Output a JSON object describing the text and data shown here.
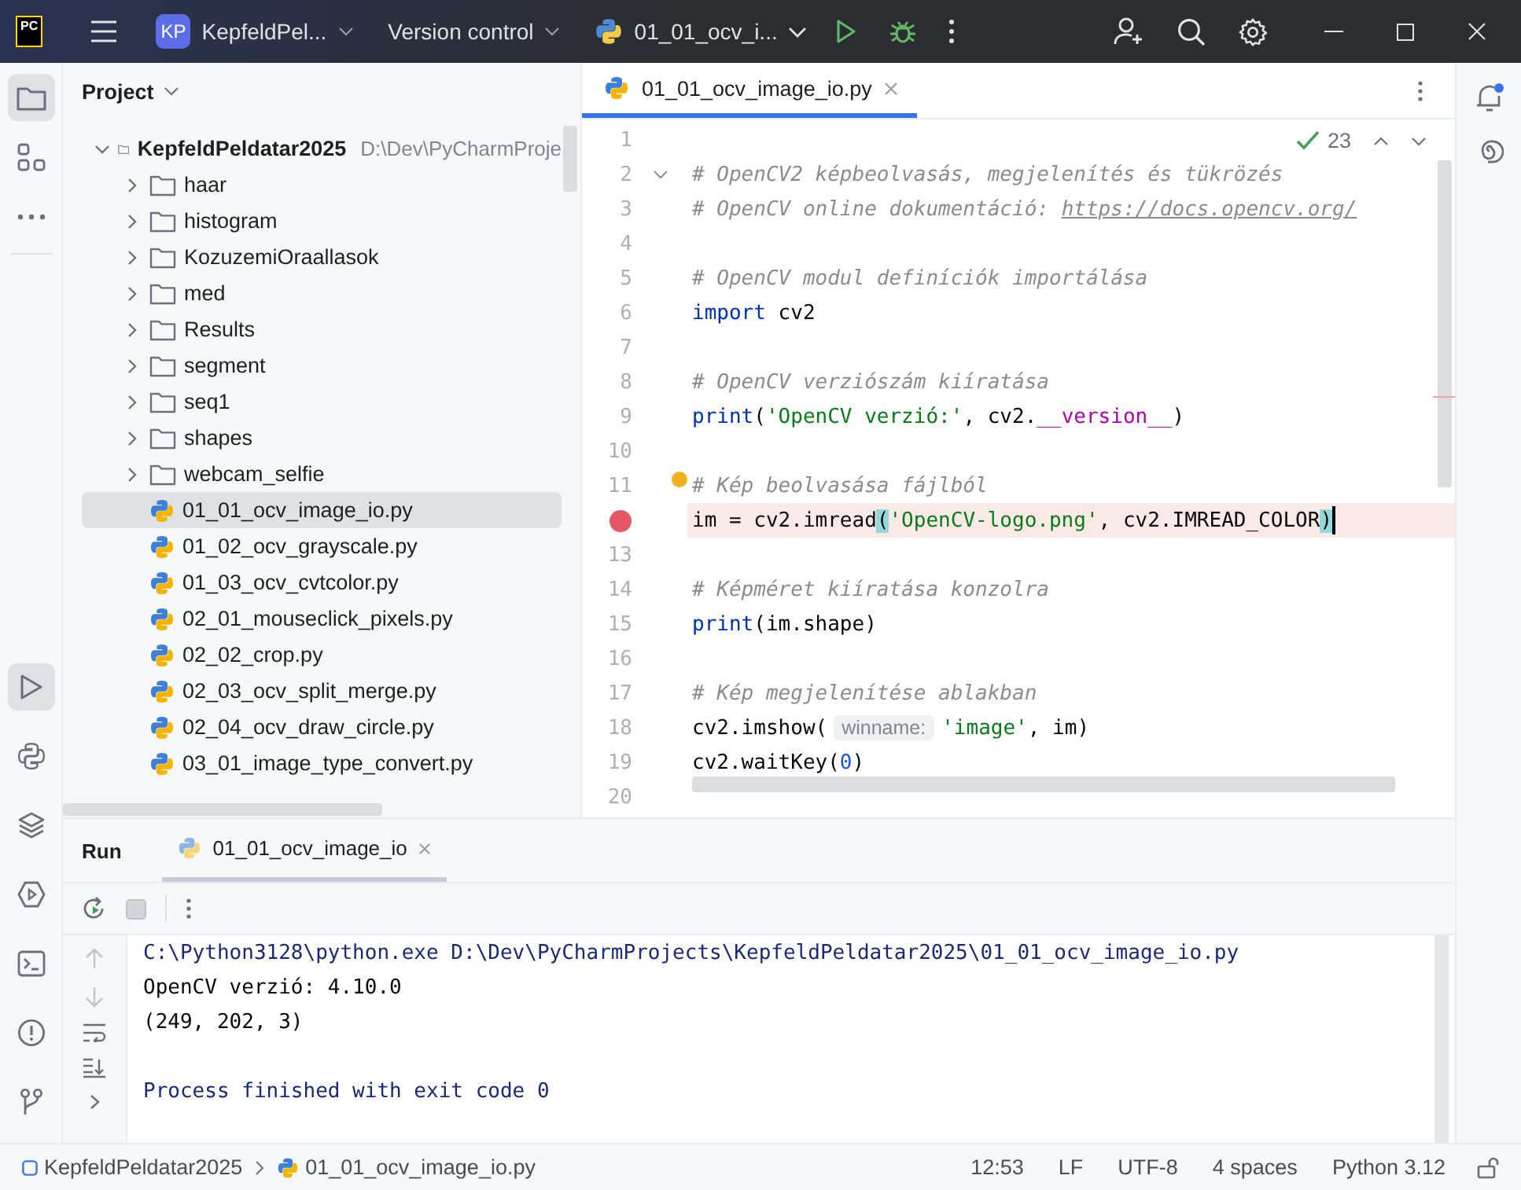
{
  "title_bar": {
    "logo": "PC",
    "project_badge": "KP",
    "project": "KepfeldPel...",
    "vcs": "Version control",
    "run_config": "01_01_ocv_i..."
  },
  "left_strip": {
    "top": [
      {
        "kind": "folder",
        "selected": true
      },
      {
        "kind": "structure",
        "selected": false
      },
      {
        "kind": "more",
        "selected": false
      }
    ],
    "bottom": [
      {
        "kind": "run",
        "selected": true
      },
      {
        "kind": "python",
        "selected": false
      },
      {
        "kind": "layers",
        "selected": false
      },
      {
        "kind": "services",
        "selected": false
      },
      {
        "kind": "terminal",
        "selected": false
      },
      {
        "kind": "problems",
        "selected": false
      },
      {
        "kind": "git",
        "selected": false
      }
    ]
  },
  "project_panel": {
    "title": "Project",
    "tree": {
      "kind": "folder",
      "name": "KepfeldPeldatar2025",
      "path": "D:\\Dev\\PyCharmProje",
      "expanded": true,
      "selected": false,
      "children": [
        {
          "kind": "folder",
          "name": "haar",
          "expanded": false,
          "selected": false
        },
        {
          "kind": "folder",
          "name": "histogram",
          "expanded": false,
          "selected": false
        },
        {
          "kind": "folder",
          "name": "KozuzemiOraallasok",
          "expanded": false,
          "selected": false
        },
        {
          "kind": "folder",
          "name": "med",
          "expanded": false,
          "selected": false
        },
        {
          "kind": "folder",
          "name": "Results",
          "expanded": false,
          "selected": false
        },
        {
          "kind": "folder",
          "name": "segment",
          "expanded": false,
          "selected": false
        },
        {
          "kind": "folder",
          "name": "seq1",
          "expanded": false,
          "selected": false
        },
        {
          "kind": "folder",
          "name": "shapes",
          "expanded": false,
          "selected": false
        },
        {
          "kind": "folder",
          "name": "webcam_selfie",
          "expanded": false,
          "selected": false
        },
        {
          "kind": "python",
          "name": "01_01_ocv_image_io.py",
          "selected": true
        },
        {
          "kind": "python",
          "name": "01_02_ocv_grayscale.py",
          "selected": false
        },
        {
          "kind": "python",
          "name": "01_03_ocv_cvtcolor.py",
          "selected": false
        },
        {
          "kind": "python",
          "name": "02_01_mouseclick_pixels.py",
          "selected": false
        },
        {
          "kind": "python",
          "name": "02_02_crop.py",
          "selected": false
        },
        {
          "kind": "python",
          "name": "02_03_ocv_split_merge.py",
          "selected": false
        },
        {
          "kind": "python",
          "name": "02_04_ocv_draw_circle.py",
          "selected": false
        },
        {
          "kind": "python",
          "name": "03_01_image_type_convert.py",
          "selected": false
        }
      ]
    }
  },
  "editor": {
    "tabs": [
      {
        "label": "01_01_ocv_image_io.py",
        "selected": true
      }
    ],
    "inspections": "23",
    "lines": [
      {
        "num": "1"
      },
      {
        "num": "2",
        "foldable": true,
        "tokens": [
          {
            "kind": "comment",
            "text": "# OpenCV2 képbeolvasás, megjelenítés és tükrözés"
          }
        ]
      },
      {
        "num": "3",
        "tokens": [
          {
            "kind": "comment",
            "text": "# OpenCV online dokumentáció: "
          },
          {
            "kind": "link",
            "text": "https://docs.opencv.org/"
          }
        ]
      },
      {
        "num": "4"
      },
      {
        "num": "5",
        "tokens": [
          {
            "kind": "comment",
            "text": "# OpenCV modul definíciók importálása"
          }
        ]
      },
      {
        "num": "6",
        "tokens": [
          {
            "kind": "keyword",
            "text": "import"
          },
          {
            "kind": "plain",
            "text": " cv2"
          }
        ]
      },
      {
        "num": "7"
      },
      {
        "num": "8",
        "tokens": [
          {
            "kind": "comment",
            "text": "# OpenCV verziószám kiíratása"
          }
        ]
      },
      {
        "num": "9",
        "tokens": [
          {
            "kind": "keyword",
            "text": "print"
          },
          {
            "kind": "plain",
            "text": "("
          },
          {
            "kind": "string",
            "text": "'OpenCV verzió:'"
          },
          {
            "kind": "plain",
            "text": ", cv2."
          },
          {
            "kind": "dunder",
            "text": "__version__"
          },
          {
            "kind": "plain",
            "text": ")"
          }
        ]
      },
      {
        "num": "10"
      },
      {
        "num": "11",
        "bulb": true,
        "tokens": [
          {
            "kind": "comment",
            "text": "# Kép beolvasása fájlból"
          }
        ]
      },
      {
        "breakpoint": true,
        "current": true,
        "tokens": [
          {
            "kind": "plain",
            "text": "im = cv2.imread"
          },
          {
            "kind": "brace",
            "text": "("
          },
          {
            "kind": "string",
            "text": "'OpenCV-logo.png'"
          },
          {
            "kind": "plain",
            "text": ", cv2.IMREAD_COLOR"
          },
          {
            "kind": "brace",
            "text": ")"
          }
        ]
      },
      {
        "num": "13"
      },
      {
        "num": "14",
        "tokens": [
          {
            "kind": "comment",
            "text": "# Képméret kiíratása konzolra"
          }
        ]
      },
      {
        "num": "15",
        "tokens": [
          {
            "kind": "keyword",
            "text": "print"
          },
          {
            "kind": "plain",
            "text": "(im.shape)"
          }
        ]
      },
      {
        "num": "16"
      },
      {
        "num": "17",
        "tokens": [
          {
            "kind": "comment",
            "text": "# Kép megjelenítése ablakban"
          }
        ]
      },
      {
        "num": "18",
        "tokens": [
          {
            "kind": "plain",
            "text": "cv2.imshow("
          },
          {
            "kind": "hint",
            "text": "winname:"
          },
          {
            "kind": "string",
            "text": "'image'"
          },
          {
            "kind": "plain",
            "text": ", im)"
          }
        ]
      },
      {
        "num": "19",
        "tokens": [
          {
            "kind": "plain",
            "text": "cv2.waitKey("
          },
          {
            "kind": "number",
            "text": "0"
          },
          {
            "kind": "plain",
            "text": ")"
          }
        ]
      },
      {
        "num": "20"
      }
    ]
  },
  "run_panel": {
    "title": "Run",
    "tabs": [
      {
        "label": "01_01_ocv_image_io",
        "selected": true
      }
    ],
    "console": [
      {
        "kind": "command",
        "text": "C:\\Python3128\\python.exe D:\\Dev\\PyCharmProjects\\KepfeldPeldatar2025\\01_01_ocv_image_io.py"
      },
      {
        "kind": "output",
        "text": "OpenCV verzió: 4.10.0"
      },
      {
        "kind": "output",
        "text": "(249, 202, 3)"
      },
      {
        "kind": "blank"
      },
      {
        "kind": "system",
        "text": "Process finished with exit code 0"
      }
    ]
  },
  "status_bar": {
    "breadcrumbs": [
      {
        "kind": "module",
        "text": "KepfeldPeldatar2025"
      },
      {
        "kind": "python",
        "text": "01_01_ocv_image_io.py"
      }
    ],
    "items": [
      "12:53",
      "LF",
      "UTF-8",
      "4 spaces",
      "Python 3.12"
    ]
  }
}
